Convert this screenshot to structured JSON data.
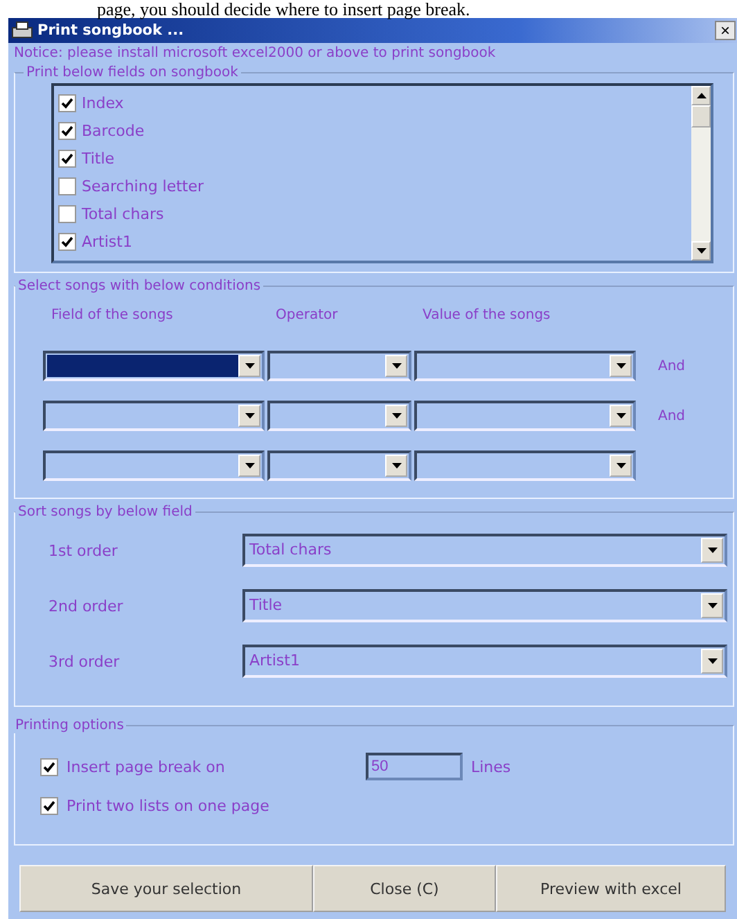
{
  "page_text": "page, you should decide where to insert page break.",
  "window": {
    "title": "Print songbook ...",
    "close": "×"
  },
  "notice": "Notice: please install microsoft excel2000 or above to print songbook",
  "fields_group": {
    "title": "Print below fields on songbook",
    "items": [
      {
        "label": "Index",
        "checked": true
      },
      {
        "label": "Barcode",
        "checked": true
      },
      {
        "label": "Title",
        "checked": true
      },
      {
        "label": "Searching letter",
        "checked": false
      },
      {
        "label": "Total chars",
        "checked": false
      },
      {
        "label": "Artist1",
        "checked": true
      }
    ]
  },
  "conditions_group": {
    "title": "Select songs with below conditions",
    "columns": [
      "Field of the songs",
      "Operator",
      "Value of the songs"
    ],
    "rows": [
      {
        "field_selected": true,
        "joiner": "And"
      },
      {
        "field_selected": false,
        "joiner": "And"
      },
      {
        "field_selected": false
      }
    ]
  },
  "sort_group": {
    "title": "Sort songs by below field",
    "orders": [
      {
        "label": "1st order",
        "value": "Total chars"
      },
      {
        "label": "2nd order",
        "value": "Title"
      },
      {
        "label": "3rd order",
        "value": "Artist1"
      }
    ]
  },
  "printing_group": {
    "title": "Printing options",
    "page_break": {
      "label": "Insert page break on",
      "checked": true,
      "value": "50",
      "unit": "Lines"
    },
    "two_lists": {
      "label": "Print two lists on one page",
      "checked": true
    }
  },
  "buttons": [
    "Save your selection",
    "Close (C)",
    "Preview with excel"
  ]
}
